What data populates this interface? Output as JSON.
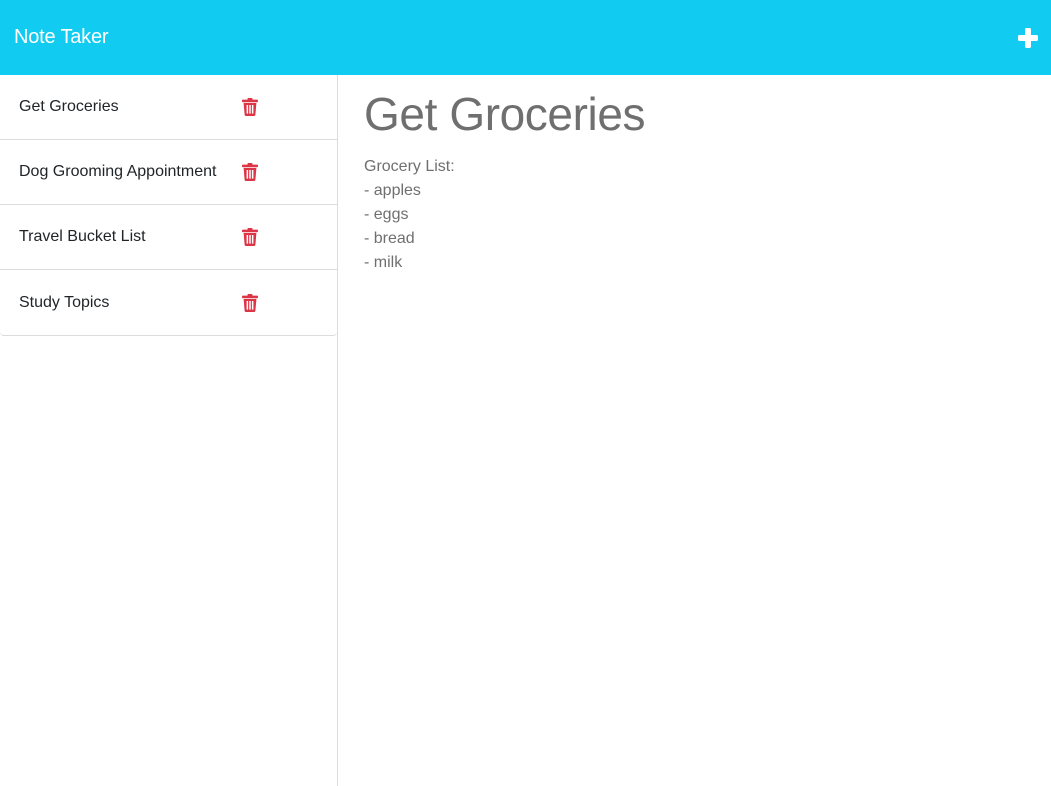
{
  "navbar": {
    "title": "Note Taker",
    "new_note_icon": "plus-icon"
  },
  "notes": [
    {
      "title": "Get Groceries",
      "delete_icon": "trash-icon"
    },
    {
      "title": "Dog Grooming Appointment",
      "delete_icon": "trash-icon"
    },
    {
      "title": "Travel Bucket List",
      "delete_icon": "trash-icon"
    },
    {
      "title": "Study Topics",
      "delete_icon": "trash-icon"
    }
  ],
  "active_note": {
    "title": "Get Groceries",
    "body_lines": [
      "Grocery List:",
      "- apples",
      "- eggs",
      "- bread",
      "- milk"
    ]
  },
  "colors": {
    "accent": "#12cbf0",
    "delete": "#dc3545",
    "note_text": "#6f6f6f"
  }
}
